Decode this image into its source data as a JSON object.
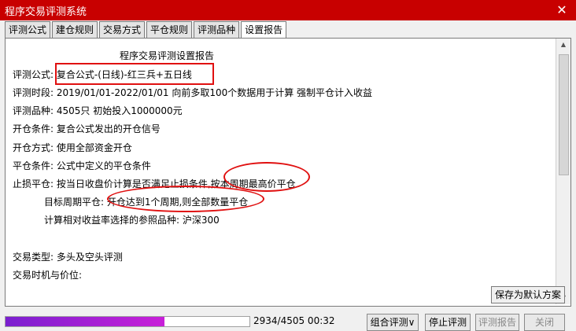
{
  "window": {
    "title": "程序交易评测系统",
    "close_glyph": "✕"
  },
  "tabs": [
    {
      "label": "评测公式"
    },
    {
      "label": "建仓规则"
    },
    {
      "label": "交易方式"
    },
    {
      "label": "平仓规则"
    },
    {
      "label": "评测品种"
    },
    {
      "label": "设置报告",
      "active": true
    }
  ],
  "report": {
    "title": "程序交易评测设置报告",
    "formula": "评测公式: 复合公式-(日线)-红三兵+五日线",
    "period": "评测时段: 2019/01/01-2022/01/01 向前多取100个数据用于计算 强制平仓计入收益",
    "instrument": "评测品种: 4505只 初始投入1000000元",
    "open_condition": "开仓条件: 复合公式发出的开仓信号",
    "open_method": "开仓方式: 使用全部资金开仓",
    "close_condition": "平仓条件: 公式中定义的平仓条件",
    "stop_loss": "止损平仓: 按当日收盘价计算是否满足止损条件,按本周期最高价平仓",
    "target_period": "目标周期平仓: 开仓达到1个周期,则全部数量平仓",
    "benchmark": "计算相对收益率选择的参照品种: 沪深300",
    "trade_type": "交易类型: 多头及空头评测",
    "trade_timing": "交易时机与价位:"
  },
  "buttons": {
    "save_default": "保存为默认方案",
    "combo_eval": "组合评测∨",
    "stop_eval": "停止评测",
    "eval_report": "评测报告",
    "close": "关闭"
  },
  "progress": {
    "text": "2934/4505 00:32",
    "fraction": 0.6513
  },
  "colors": {
    "titlebar": "#c80000",
    "annotation": "#e01010",
    "progress": "#b01fd6"
  }
}
